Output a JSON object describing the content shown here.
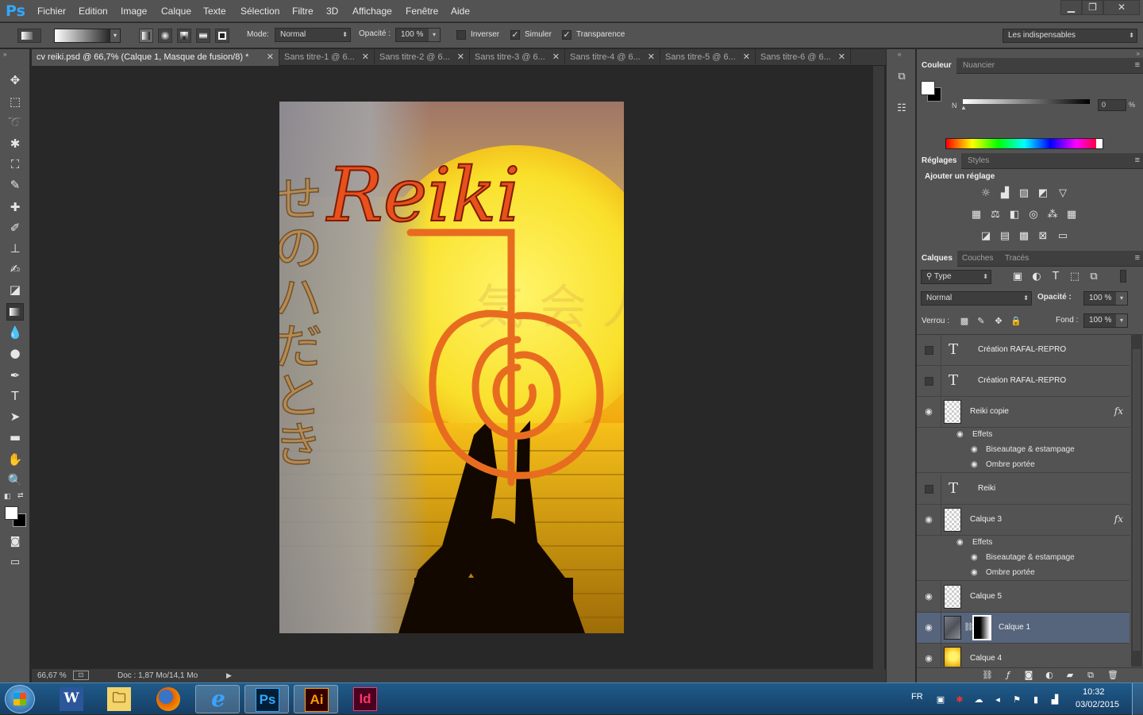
{
  "app": {
    "logo": "Ps"
  },
  "menu": [
    "Fichier",
    "Edition",
    "Image",
    "Calque",
    "Texte",
    "Sélection",
    "Filtre",
    "3D",
    "Affichage",
    "Fenêtre",
    "Aide"
  ],
  "window_controls": {
    "minimize": "▁",
    "restore": "❐",
    "close": "✕"
  },
  "options": {
    "mode_label": "Mode:",
    "mode_value": "Normal",
    "opacity_label": "Opacité :",
    "opacity_value": "100 %",
    "inverser": "Inverser",
    "simuler": "Simuler",
    "transparence": "Transparence",
    "workspace": "Les indispensables",
    "inverser_checked": false,
    "simuler_checked": true,
    "transparence_checked": true
  },
  "tabs": [
    {
      "label": "cv reiki.psd @ 66,7% (Calque 1, Masque de fusion/8) *",
      "active": true
    },
    {
      "label": "Sans titre-1 @ 6...",
      "active": false
    },
    {
      "label": "Sans titre-2 @ 6...",
      "active": false
    },
    {
      "label": "Sans titre-3 @ 6...",
      "active": false
    },
    {
      "label": "Sans titre-4 @ 6...",
      "active": false
    },
    {
      "label": "Sans titre-5 @ 6...",
      "active": false
    },
    {
      "label": "Sans titre-6 @ 6...",
      "active": false
    }
  ],
  "artwork": {
    "title": "Reiki",
    "kanji_left": "せのハだとき",
    "kanji_faint": "気 会 人"
  },
  "status": {
    "zoom": "66,67 %",
    "doc": "Doc : 1,87 Mo/14,1 Mo"
  },
  "color_panel": {
    "tabs": [
      "Couleur",
      "Nuancier"
    ],
    "channel": "N",
    "value": "0",
    "unit": "%"
  },
  "adjustments_panel": {
    "tabs": [
      "Réglages",
      "Styles"
    ],
    "heading": "Ajouter un réglage"
  },
  "layers_panel": {
    "tabs": [
      "Calques",
      "Couches",
      "Tracés"
    ],
    "filter": "Type",
    "blend_mode": "Normal",
    "opacity_label": "Opacité :",
    "opacity_value": "100 %",
    "lock_label": "Verrou :",
    "fill_label": "Fond :",
    "fill_value": "100 %",
    "layers": [
      {
        "name": "Création RAFAL-REPRO",
        "kind": "text",
        "visible": false
      },
      {
        "name": "Création RAFAL-REPRO",
        "kind": "text",
        "visible": false
      },
      {
        "name": "Reiki copie",
        "kind": "raster",
        "visible": true,
        "fx": "fx"
      },
      {
        "name": "Reiki",
        "kind": "text",
        "visible": false
      },
      {
        "name": "Calque 3",
        "kind": "raster",
        "visible": true,
        "fx": "fx"
      },
      {
        "name": "Calque 5",
        "kind": "raster",
        "visible": true
      },
      {
        "name": "Calque 1",
        "kind": "masked",
        "visible": true,
        "selected": true
      },
      {
        "name": "Calque 4",
        "kind": "image",
        "visible": true
      }
    ],
    "effects_label": "Effets",
    "effect_bevel": "Biseautage & estampage",
    "effect_shadow": "Ombre portée"
  },
  "taskbar": {
    "apps": [
      {
        "name": "word",
        "label": "W"
      },
      {
        "name": "explorer",
        "label": "🗀"
      },
      {
        "name": "firefox",
        "label": ""
      },
      {
        "name": "ie",
        "label": "e"
      },
      {
        "name": "photoshop",
        "label": "Ps"
      },
      {
        "name": "illustrator",
        "label": "Ai"
      },
      {
        "name": "indesign",
        "label": "Id"
      }
    ],
    "lang": "FR",
    "time": "10:32",
    "date": "03/02/2015"
  },
  "colors": {
    "accent": "#31a8ff",
    "panel_bg": "#535353",
    "selected_layer": "#56647c",
    "artwork_title": "#e8501c"
  }
}
